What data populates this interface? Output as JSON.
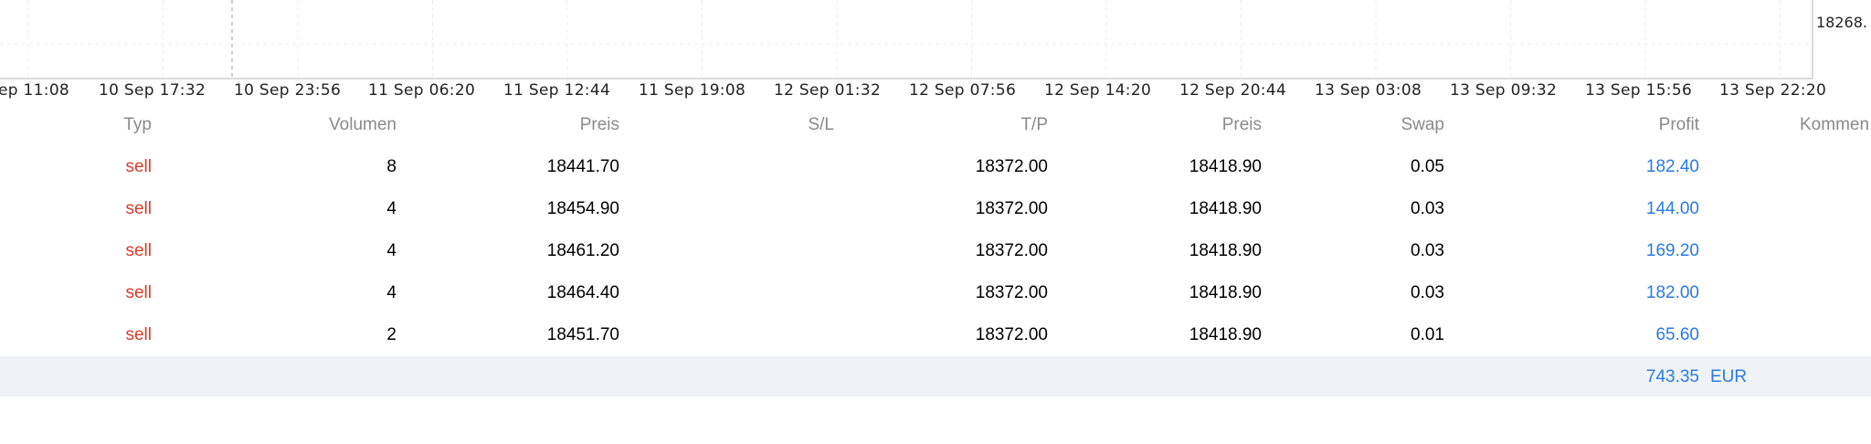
{
  "chart": {
    "price_label": "18268.",
    "time_labels": [
      "ep 11:08",
      "10 Sep 17:32",
      "10 Sep 23:56",
      "11 Sep 06:20",
      "11 Sep 12:44",
      "11 Sep 19:08",
      "12 Sep 01:32",
      "12 Sep 07:56",
      "12 Sep 14:20",
      "12 Sep 20:44",
      "13 Sep 03:08",
      "13 Sep 09:32",
      "13 Sep 15:56",
      "13 Sep 22:20"
    ]
  },
  "table": {
    "headers": {
      "typ": "Typ",
      "volumen": "Volumen",
      "preis_open": "Preis",
      "sl": "S/L",
      "tp": "T/P",
      "preis_current": "Preis",
      "swap": "Swap",
      "profit": "Profit",
      "kommentar": "Kommen"
    },
    "rows": [
      {
        "typ": "sell",
        "volumen": "8",
        "preis_open": "18441.70",
        "sl": "",
        "tp": "18372.00",
        "preis_current": "18418.90",
        "swap": "0.05",
        "profit": "182.40"
      },
      {
        "typ": "sell",
        "volumen": "4",
        "preis_open": "18454.90",
        "sl": "",
        "tp": "18372.00",
        "preis_current": "18418.90",
        "swap": "0.03",
        "profit": "144.00"
      },
      {
        "typ": "sell",
        "volumen": "4",
        "preis_open": "18461.20",
        "sl": "",
        "tp": "18372.00",
        "preis_current": "18418.90",
        "swap": "0.03",
        "profit": "169.20"
      },
      {
        "typ": "sell",
        "volumen": "4",
        "preis_open": "18464.40",
        "sl": "",
        "tp": "18372.00",
        "preis_current": "18418.90",
        "swap": "0.03",
        "profit": "182.00"
      },
      {
        "typ": "sell",
        "volumen": "2",
        "preis_open": "18451.70",
        "sl": "",
        "tp": "18372.00",
        "preis_current": "18418.90",
        "swap": "0.01",
        "profit": "65.60"
      }
    ],
    "total": {
      "profit": "743.35",
      "currency": "EUR"
    }
  },
  "colors": {
    "sell": "#d93a2b",
    "profit": "#2a7ae2",
    "total_bg": "#eff3f7",
    "header": "#8a8a8a"
  }
}
